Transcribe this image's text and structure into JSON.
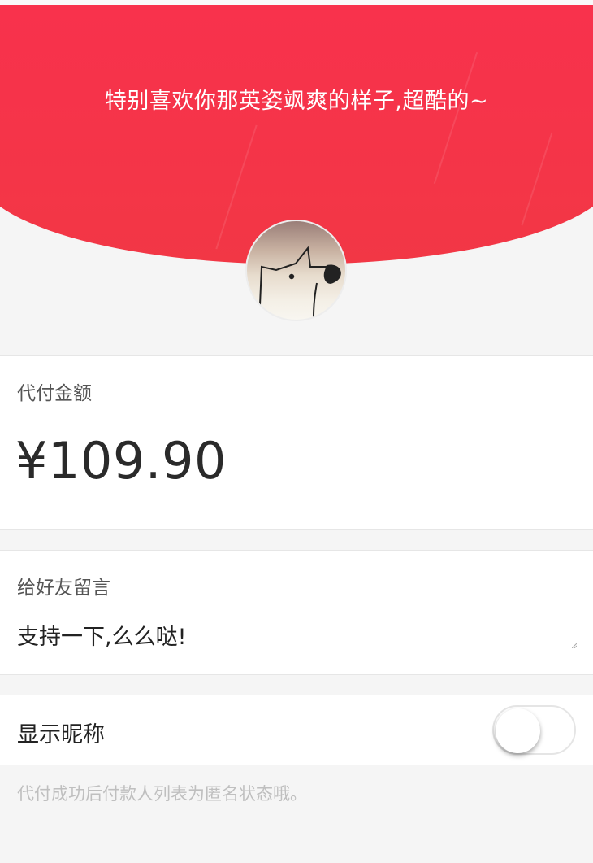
{
  "header": {
    "slogan": "特别喜欢你那英姿飒爽的样子,超酷的~",
    "brand_color": "#f7334a"
  },
  "avatar": {
    "icon": "dog-avatar-icon"
  },
  "amount_card": {
    "label": "代付金额",
    "amount": "¥109.90"
  },
  "message_card": {
    "label": "给好友留言",
    "value": "支持一下,么么哒!"
  },
  "nickname_card": {
    "label": "显示昵称",
    "toggle_on": false
  },
  "footer": {
    "hint": "代付成功后付款人列表为匿名状态哦。"
  }
}
